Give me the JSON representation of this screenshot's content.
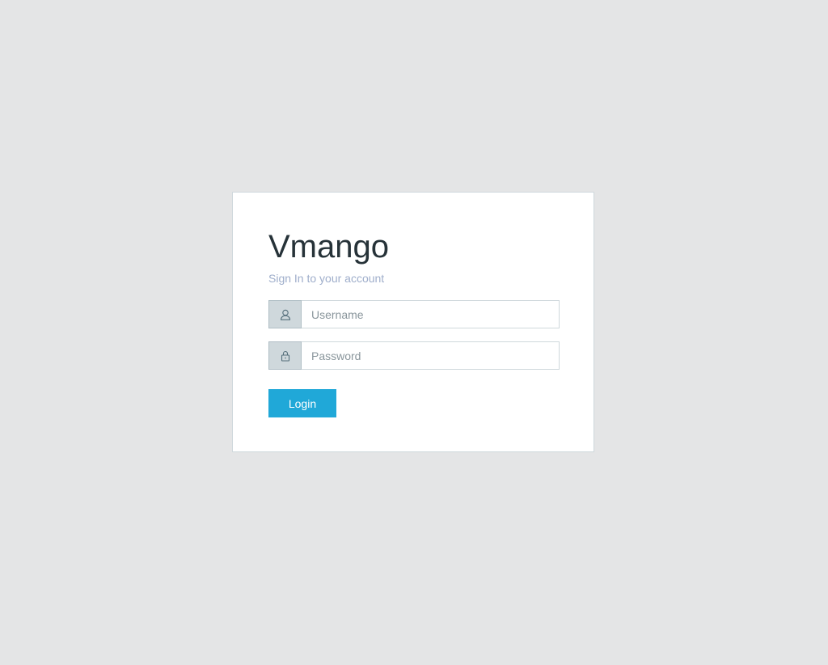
{
  "login": {
    "title": "Vmango",
    "subtitle": "Sign In to your account",
    "username": {
      "icon": "user-icon",
      "placeholder": "Username",
      "value": ""
    },
    "password": {
      "icon": "lock-icon",
      "placeholder": "Password",
      "value": ""
    },
    "button_label": "Login"
  },
  "colors": {
    "background": "#e4e5e6",
    "accent": "#20a8d8",
    "title": "#263238",
    "subtitle": "#9faecb"
  }
}
